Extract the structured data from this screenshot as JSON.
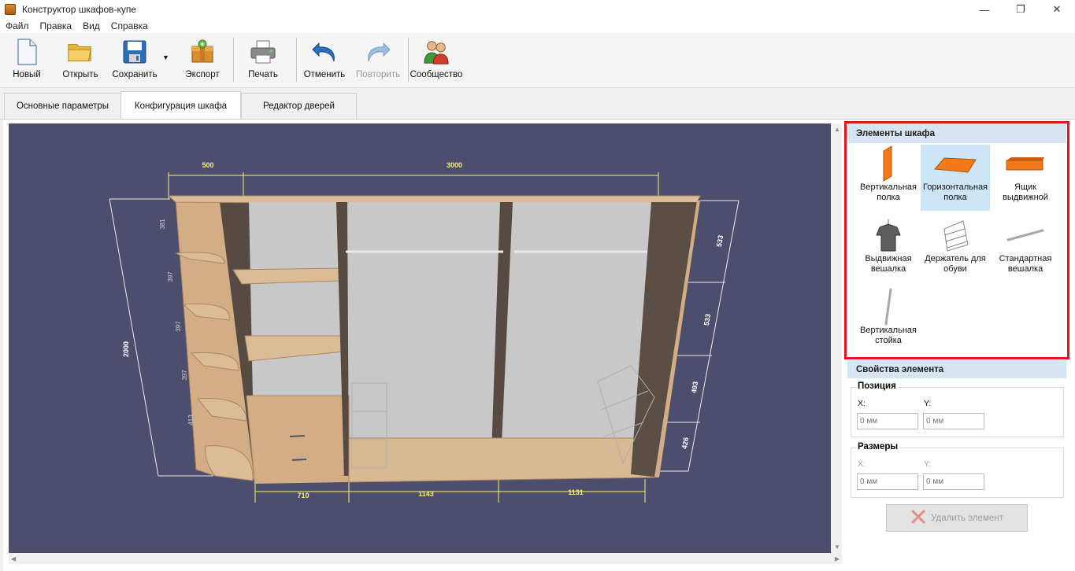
{
  "window": {
    "title": "Конструктор шкафов-купе",
    "controls": {
      "minimize": "—",
      "maximize": "❐",
      "close": "✕"
    }
  },
  "menu": [
    "Файл",
    "Правка",
    "Вид",
    "Справка"
  ],
  "toolbar": {
    "new": "Новый",
    "open": "Открыть",
    "save": "Сохранить",
    "export": "Экспорт",
    "print": "Печать",
    "undo": "Отменить",
    "redo": "Повторить",
    "community": "Сообщество"
  },
  "tabs": [
    "Основные параметры",
    "Конфигурация шкафа",
    "Редактор дверей"
  ],
  "active_tab": "Конфигурация шкафа",
  "viewport": {
    "dimensions": {
      "top_left": "500",
      "top_right": "3000",
      "height": "2000",
      "bottom": [
        "710",
        "1143",
        "1131"
      ],
      "left_shelves": [
        "381",
        "397",
        "397",
        "397",
        "413"
      ],
      "right_shelves": [
        "533",
        "533",
        "493",
        "426"
      ]
    },
    "colors": {
      "background": "#4d4d6e",
      "wood": "#d9b894",
      "dark_wood": "#5b4e45",
      "back_panel": "#c6c6c6",
      "dimension_line": "#f2f277"
    }
  },
  "elements_panel": {
    "title": "Элементы шкафа",
    "items": [
      {
        "label": "Вертикальная полка",
        "icon": "vertical-shelf-icon",
        "selected": false
      },
      {
        "label": "Горизонтальная полка",
        "icon": "horizontal-shelf-icon",
        "selected": true
      },
      {
        "label": "Ящик выдвижной",
        "icon": "drawer-icon",
        "selected": false
      },
      {
        "label": "Выдвижная вешалка",
        "icon": "pullout-hanger-icon",
        "selected": false
      },
      {
        "label": "Держатель для обуви",
        "icon": "shoe-rack-icon",
        "selected": false
      },
      {
        "label": "Стандартная вешалка",
        "icon": "rail-icon",
        "selected": false
      },
      {
        "label": "Вертикальная стойка",
        "icon": "vertical-post-icon",
        "selected": false
      }
    ],
    "highlight_color": "#e3151a"
  },
  "properties": {
    "title": "Свойства элемента",
    "position": {
      "title": "Позиция",
      "x_label": "X:",
      "y_label": "Y:",
      "x_placeholder": "0 мм",
      "y_placeholder": "0 мм"
    },
    "size": {
      "title": "Размеры",
      "x_label": "X:",
      "y_label": "Y:",
      "x_placeholder": "0 мм",
      "y_placeholder": "0 мм"
    },
    "delete_button": "Удалить элемент"
  }
}
